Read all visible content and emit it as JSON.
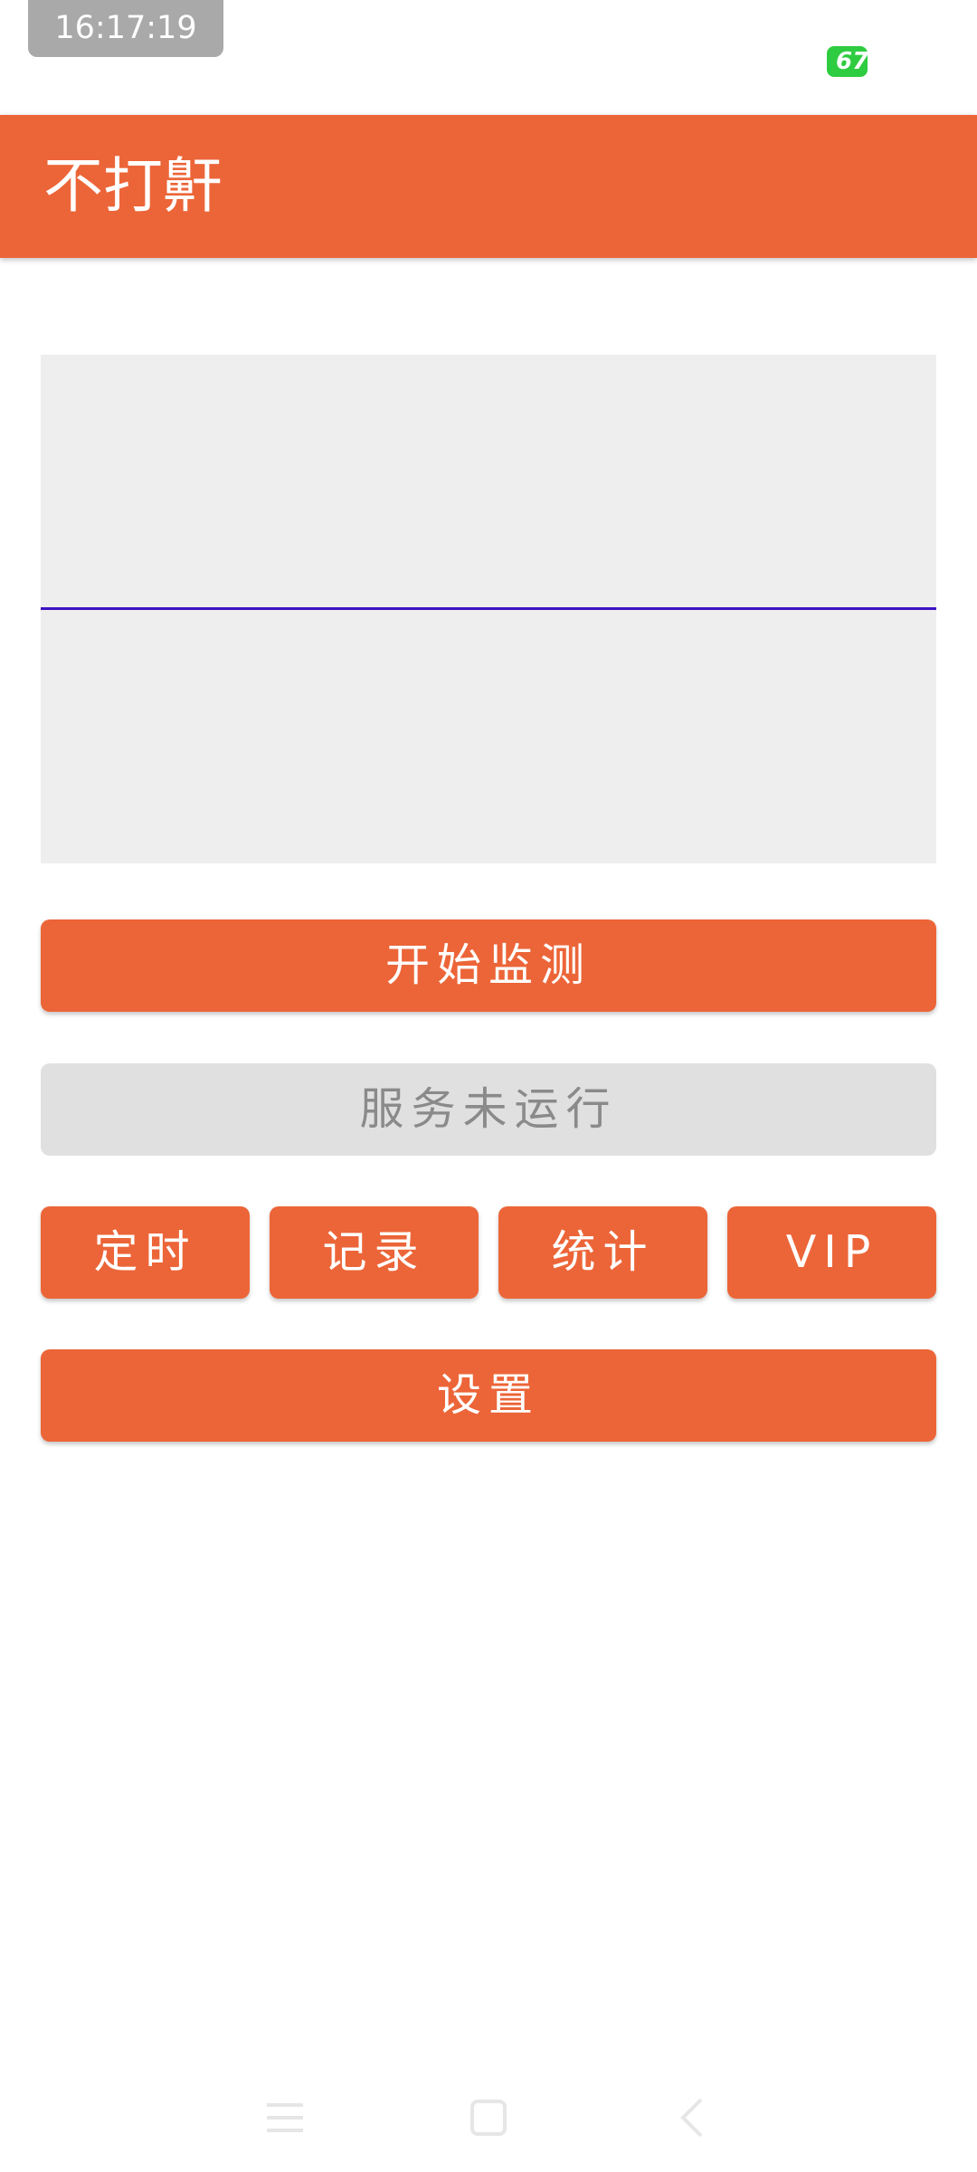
{
  "status_bar": {
    "time": "16:17:19",
    "battery": "67"
  },
  "app_bar": {
    "title": "不打鼾"
  },
  "monitor": {
    "waveform_level": 0
  },
  "buttons": {
    "start_monitoring": "开始监测",
    "service_status": "服务未运行",
    "timer": "定时",
    "record": "记录",
    "stats": "统计",
    "vip": "VIP",
    "settings": "设置"
  },
  "colors": {
    "accent": "#ec6538",
    "panel": "#eeeeee",
    "waveform": "#3d11c4",
    "disabled": "#e0e0e0",
    "battery": "#2ecc40"
  },
  "nav": {
    "icons": [
      "menu-icon",
      "home-icon",
      "back-icon"
    ]
  }
}
